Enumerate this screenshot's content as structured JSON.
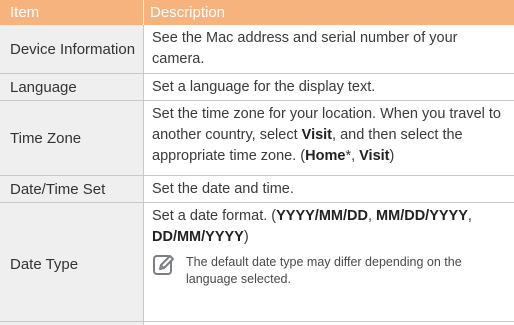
{
  "header": {
    "item": "Item",
    "description": "Description"
  },
  "rows": [
    {
      "item": "Device Information",
      "desc": "See the Mac address and serial number of your camera."
    },
    {
      "item": "Language",
      "desc": "Set a language for the display text."
    },
    {
      "item": "Time Zone",
      "desc_a": "Set the time zone for your location. When you travel to another country, select ",
      "desc_b": "Visit",
      "desc_c": ", and then select the appropriate time zone. (",
      "desc_d": "Home",
      "desc_e": "*, ",
      "desc_f": "Visit",
      "desc_g": ")"
    },
    {
      "item": "Date/Time Set",
      "desc": "Set the date and time."
    },
    {
      "item": "Date Type",
      "desc_a": "Set a date format. (",
      "desc_b": "YYYY/MM/DD",
      "desc_c": ", ",
      "desc_d": "MM/DD/YYYY",
      "desc_e": ", ",
      "desc_f": "DD/MM/YYYY",
      "desc_g": ")",
      "note": "The default date type may differ depending on the language selected."
    }
  ],
  "icons": {
    "note": "note-pencil-icon"
  },
  "colors": {
    "header_bg": "#f7b37d",
    "item_bg": "#efefef",
    "icon": "#7a7f86"
  }
}
